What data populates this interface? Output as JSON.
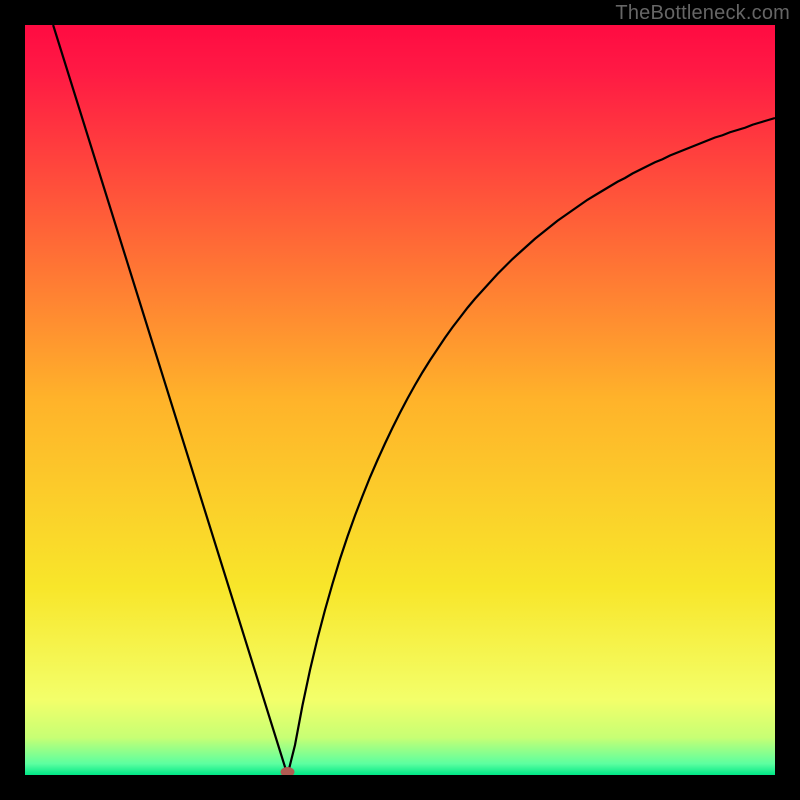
{
  "watermark": "TheBottleneck.com",
  "chart_data": {
    "type": "line",
    "title": "",
    "xlabel": "",
    "ylabel": "",
    "xlim": [
      0,
      100
    ],
    "ylim": [
      0,
      100
    ],
    "x": [
      0,
      1,
      2,
      3,
      4,
      5,
      6,
      7,
      8,
      9,
      10,
      11,
      12,
      13,
      14,
      15,
      16,
      17,
      18,
      19,
      20,
      21,
      22,
      23,
      24,
      25,
      26,
      27,
      28,
      29,
      30,
      31,
      32,
      33,
      34,
      35,
      36,
      37,
      38,
      39,
      40,
      41,
      42,
      43,
      44,
      45,
      46,
      47,
      48,
      49,
      50,
      51,
      52,
      53,
      54,
      55,
      56,
      57,
      58,
      59,
      60,
      61,
      62,
      63,
      64,
      65,
      66,
      67,
      68,
      69,
      70,
      71,
      72,
      73,
      74,
      75,
      76,
      77,
      78,
      79,
      80,
      81,
      82,
      83,
      84,
      85,
      86,
      87,
      88,
      89,
      90,
      91,
      92,
      93,
      94,
      95,
      96,
      97,
      98,
      99,
      100
    ],
    "values": [
      112.0,
      108.8,
      105.6,
      102.4,
      99.2,
      96.0,
      92.8,
      89.6,
      86.4,
      83.2,
      80.0,
      76.8,
      73.6,
      70.4,
      67.2,
      64.0,
      60.8,
      57.6,
      54.4,
      51.2,
      48.0,
      44.8,
      41.6,
      38.4,
      35.2,
      32.0,
      28.8,
      25.6,
      22.4,
      19.2,
      16.0,
      12.8,
      9.6,
      6.4,
      3.2,
      0.0,
      4.0,
      9.3,
      14.0,
      18.2,
      22.0,
      25.5,
      28.8,
      31.8,
      34.6,
      37.2,
      39.7,
      42.0,
      44.2,
      46.3,
      48.3,
      50.2,
      52.0,
      53.7,
      55.3,
      56.8,
      58.3,
      59.7,
      61.0,
      62.3,
      63.5,
      64.6,
      65.7,
      66.8,
      67.8,
      68.8,
      69.7,
      70.6,
      71.5,
      72.3,
      73.1,
      73.9,
      74.6,
      75.3,
      76.0,
      76.7,
      77.3,
      77.9,
      78.5,
      79.1,
      79.6,
      80.2,
      80.7,
      81.2,
      81.7,
      82.1,
      82.6,
      83.0,
      83.4,
      83.8,
      84.2,
      84.6,
      85.0,
      85.3,
      85.7,
      86.0,
      86.3,
      86.7,
      87.0,
      87.3,
      87.6
    ],
    "marker": {
      "x": 35,
      "y": 0,
      "color": "#b15b52"
    },
    "gradient_stops": [
      {
        "offset": 0.0,
        "color": "#ff0b42"
      },
      {
        "offset": 0.06,
        "color": "#ff1944"
      },
      {
        "offset": 0.5,
        "color": "#ffb32a"
      },
      {
        "offset": 0.75,
        "color": "#f8e62a"
      },
      {
        "offset": 0.9,
        "color": "#f3ff6a"
      },
      {
        "offset": 0.95,
        "color": "#c7ff74"
      },
      {
        "offset": 0.985,
        "color": "#5cffa0"
      },
      {
        "offset": 1.0,
        "color": "#00e786"
      }
    ]
  }
}
